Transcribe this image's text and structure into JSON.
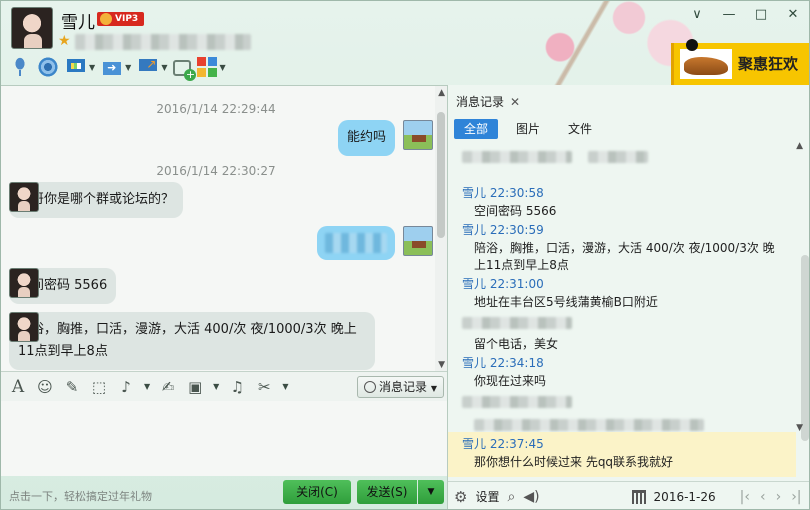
{
  "window": {
    "contact_name": "雪儿",
    "vip_label": "VIP3",
    "controls": [
      "∨",
      "—",
      "□",
      "✕"
    ]
  },
  "ad": {
    "text": "聚惠狂欢"
  },
  "chat": {
    "timestamps": [
      "2016/1/14 22:29:44",
      "2016/1/14 22:30:27"
    ],
    "messages": [
      {
        "from": "me",
        "text": "能约吗"
      },
      {
        "from": "other",
        "text": "哥哥你是哪个群或论坛的？"
      },
      {
        "from": "other",
        "text": "空间密码  5566"
      },
      {
        "from": "other",
        "text_line1": "陪浴，胸推，口活，漫游，大活 400/次 夜/1000/3次 晚上",
        "text_line2": "11点到早上8点"
      }
    ]
  },
  "input_toolbar": {
    "history_button": "消息记录"
  },
  "footer": {
    "hint": "点击一下，轻松搞定过年礼物",
    "close_button": "关闭(C)",
    "send_button": "发送(S)"
  },
  "history": {
    "tab_label": "消息记录",
    "filters": [
      "全部",
      "图片",
      "文件"
    ],
    "records": [
      {
        "who": "雪儿 22:30:58",
        "text": "空间密码  5566"
      },
      {
        "who": "雪儿 22:30:59",
        "text_line1": "陪浴，胸推，口活，漫游，大活 400/次 夜/1000/3次 晚",
        "text_line2": "上11点到早上8点"
      },
      {
        "who": "雪儿 22:31:00",
        "text": "地址在丰台区5号线蒲黄榆B口附近"
      },
      {
        "text": "留个电话，美女"
      },
      {
        "who": "雪儿 22:34:18",
        "text": "你现在过来吗"
      },
      {
        "who": "雪儿 22:37:45",
        "text": "那你想什么时候过来 先qq联系我就好"
      }
    ],
    "settings_label": "设置",
    "date": "2016-1-26"
  },
  "icons": {
    "toolbar": [
      "microphone-icon",
      "camera-icon",
      "screen-share-icon",
      "file-transfer-icon",
      "remote-assist-icon",
      "new-message-icon",
      "apps-icon"
    ],
    "input": [
      "font-icon",
      "emoji-icon",
      "magic-icon",
      "screenshot-icon",
      "voice-icon",
      "edit-icon",
      "image-icon",
      "music-icon",
      "scissors-icon"
    ]
  }
}
